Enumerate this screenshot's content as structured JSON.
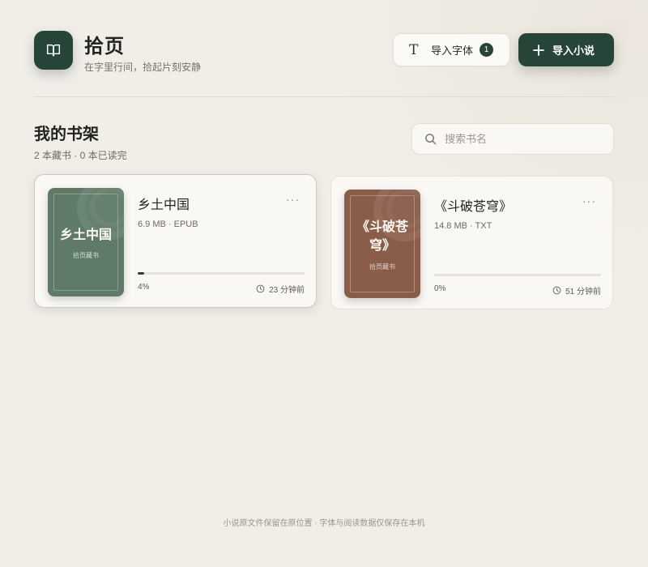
{
  "app": {
    "title": "拾页",
    "subtitle": "在字里行间，拾起片刻安静",
    "logo_icon": "book-icon",
    "accent_color": "#264538"
  },
  "toolbar": {
    "import_font_label": "导入字体",
    "import_font_icon": "text-t-icon",
    "font_count": "1",
    "import_novel_label": "导入小说",
    "import_novel_icon": "plus-icon"
  },
  "shelf": {
    "title": "我的书架",
    "count_text": "2 本藏书 · 0 本已读完"
  },
  "search": {
    "placeholder": "搜索书名",
    "value": ""
  },
  "books": [
    {
      "title": "乡土中国",
      "cover_title": "乡土中国",
      "cover_brand": "拾页藏书",
      "cover_color": "#5f7b67",
      "meta": "6.9 MB · EPUB",
      "progress": 0.04,
      "progress_text": "4%",
      "last_read": "23 分钟前",
      "more_label": "···"
    },
    {
      "title": "《斗破苍穹》",
      "cover_title": "《斗破苍穹》",
      "cover_brand": "拾页藏书",
      "cover_color": "#8a5d4a",
      "meta": "14.8 MB · TXT",
      "progress": 0,
      "progress_text": "0%",
      "last_read": "51 分钟前",
      "more_label": "···"
    }
  ],
  "footer": {
    "text": "小说原文件保留在原位置 · 字体与阅读数据仅保存在本机"
  }
}
